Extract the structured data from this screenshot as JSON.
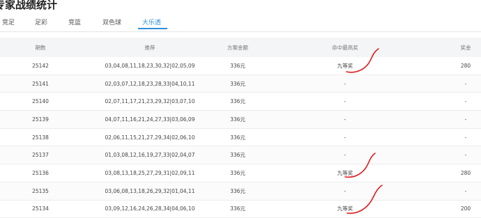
{
  "page": {
    "title": "专家战绩统计"
  },
  "tabs": [
    {
      "label": "竞足",
      "active": false
    },
    {
      "label": "足彩",
      "active": false
    },
    {
      "label": "竞篮",
      "active": false
    },
    {
      "label": "双色球",
      "active": false
    },
    {
      "label": "大乐透",
      "active": true
    }
  ],
  "table": {
    "headers": {
      "issue": "期数",
      "recommend": "推荐",
      "amount": "方案金额",
      "hit": "命中最高奖",
      "prize": "奖金"
    },
    "rows": [
      {
        "issue": "25142",
        "recommend": "03,04,08,11,18,23,30,32|02,05,09",
        "amount": "336元",
        "hit": "九等奖",
        "prize": "280"
      },
      {
        "issue": "25141",
        "recommend": "02,03,07,12,18,23,28,33|04,10,11",
        "amount": "336元",
        "hit": "-",
        "prize": "-"
      },
      {
        "issue": "25140",
        "recommend": "02,07,11,17,21,23,29,32|03,07,10",
        "amount": "336元",
        "hit": "-",
        "prize": "-"
      },
      {
        "issue": "25139",
        "recommend": "04,07,11,16,21,24,27,33|03,06,09",
        "amount": "336元",
        "hit": "-",
        "prize": "-"
      },
      {
        "issue": "25138",
        "recommend": "02,06,11,15,21,27,29,34|02,06,10",
        "amount": "336元",
        "hit": "-",
        "prize": "-"
      },
      {
        "issue": "25137",
        "recommend": "01,03,08,12,16,19,27,33|02,04,07",
        "amount": "336元",
        "hit": "-",
        "prize": "-"
      },
      {
        "issue": "25136",
        "recommend": "03,08,13,18,25,27,29,31|02,09,11",
        "amount": "336元",
        "hit": "九等奖",
        "prize": "280"
      },
      {
        "issue": "25135",
        "recommend": "03,06,08,13,18,26,29,32|01,04,11",
        "amount": "336元",
        "hit": "-",
        "prize": "-"
      },
      {
        "issue": "25134",
        "recommend": "03,09,12,16,24,26,28,34|04,06,10",
        "amount": "336元",
        "hit": "九等奖",
        "prize": "200"
      }
    ]
  },
  "colors": {
    "accent": "#2f8fd8",
    "annotation": "#e0191b"
  }
}
